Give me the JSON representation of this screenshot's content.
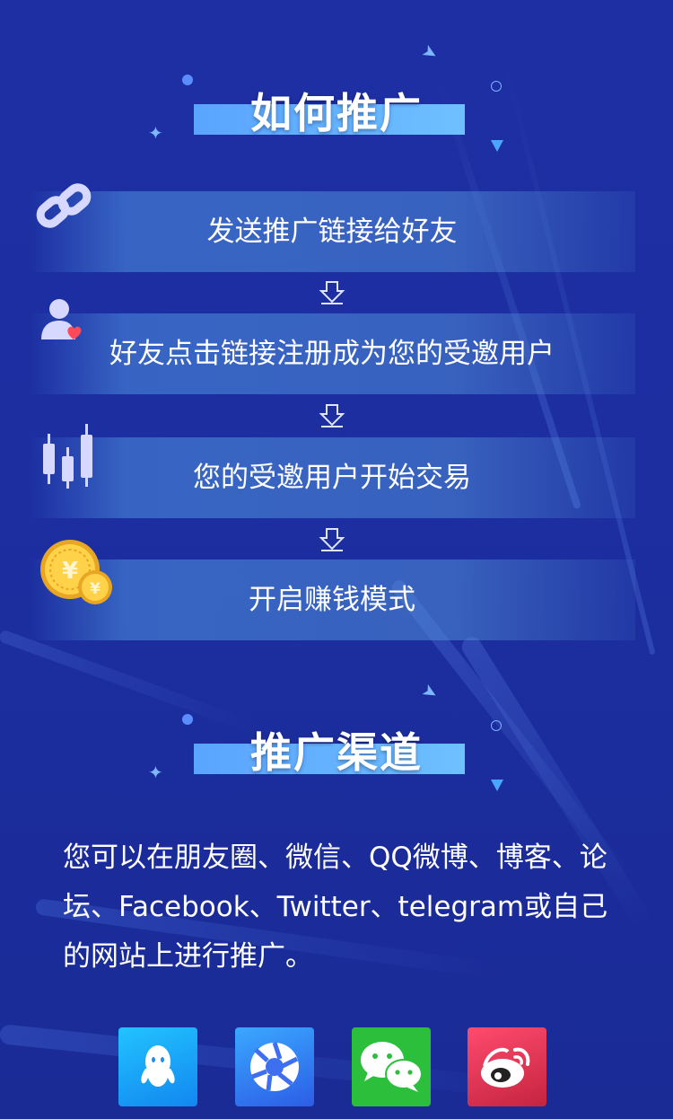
{
  "section1": {
    "title": "如何推广"
  },
  "steps": [
    {
      "label": "发送推广链接给好友",
      "icon": "link-icon"
    },
    {
      "label": "好友点击链接注册成为您的受邀用户",
      "icon": "user-heart-icon"
    },
    {
      "label": "您的受邀用户开始交易",
      "icon": "candlestick-icon"
    },
    {
      "label": "开启赚钱模式",
      "icon": "gold-coins-icon"
    }
  ],
  "section2": {
    "title": "推广渠道",
    "description": "您可以在朋友圈、微信、QQ微博、博客、论坛、Facebook、Twitter、telegram或自己的网站上进行推广。"
  },
  "channels": [
    {
      "icon": "qq-icon",
      "color": "#1aa7f5"
    },
    {
      "icon": "aperture-icon",
      "color": "#3d6ff0"
    },
    {
      "icon": "wechat-icon",
      "color": "#2bbf3c"
    },
    {
      "icon": "weibo-icon",
      "color": "#d8304e"
    }
  ],
  "colors": {
    "background": "#1c2ea0",
    "accent": "#5aa4ff"
  }
}
